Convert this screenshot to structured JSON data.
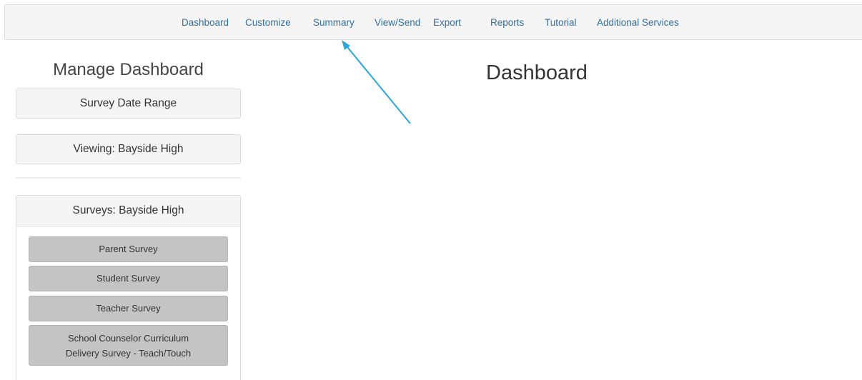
{
  "nav": {
    "items": [
      "Dashboard",
      "Customize",
      "Summary",
      "View/Send",
      "Export",
      "Reports",
      "Tutorial",
      "Additional Services"
    ]
  },
  "sidebar": {
    "title": "Manage Dashboard",
    "date_range_label": "Survey Date Range",
    "viewing_label": "Viewing: Bayside High",
    "surveys_header": "Surveys: Bayside High",
    "surveys": [
      "Parent Survey",
      "Student Survey",
      "Teacher Survey",
      "School Counselor Curriculum",
      "Delivery Survey - Teach/Touch"
    ]
  },
  "main": {
    "title": "Dashboard"
  },
  "annotation": {
    "arrow_color": "#2aa7dc",
    "arrow_target": "Summary"
  }
}
